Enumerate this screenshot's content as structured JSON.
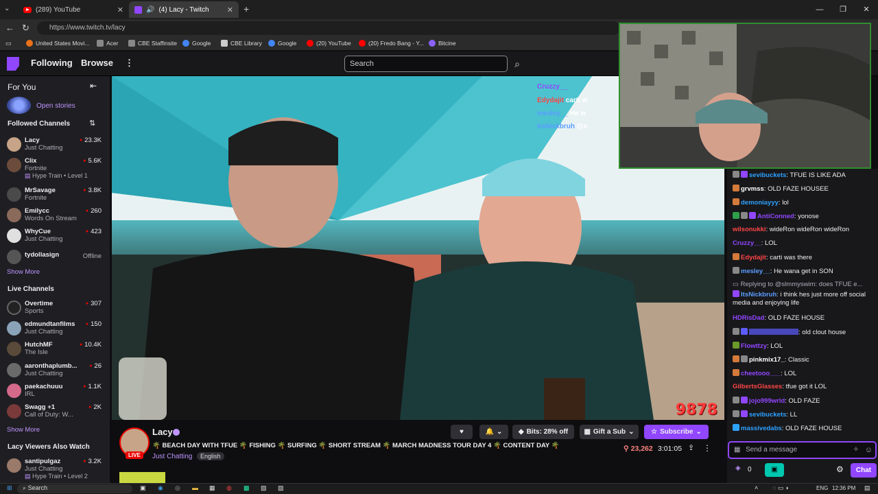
{
  "browser": {
    "tabs": [
      {
        "label": "(289) YouTube",
        "icon": "youtube-icon"
      },
      {
        "label": "(4) Lacy - Twitch",
        "icon": "twitch-icon"
      }
    ],
    "url": "https://www.twitch.tv/lacy",
    "bookmarks": [
      "United States Movi...",
      "Acer",
      "CBE Staffinsite",
      "Google",
      "CBE Library",
      "Google",
      "(20) YouTube",
      "(20) Fredo Bang - Y...",
      "Bitcine"
    ]
  },
  "nav": {
    "following": "Following",
    "browse": "Browse",
    "search_placeholder": "Search"
  },
  "sidebar": {
    "for_you": "For You",
    "open_stories": "Open stories",
    "followed_heading": "Followed Channels",
    "followed": [
      {
        "name": "Lacy",
        "game": "Just Chatting",
        "viewers": "23.3K",
        "color": "#c7a487"
      },
      {
        "name": "Clix",
        "game": "Fortnite",
        "viewers": "5.6K",
        "hype": "Hype Train • Level 1",
        "color": "#6b4c3b"
      },
      {
        "name": "MrSavage",
        "game": "Fortnite",
        "viewers": "3.8K",
        "color": "#4a4a4a"
      },
      {
        "name": "Emilycc",
        "game": "Words On Stream",
        "viewers": "260",
        "color": "#8a6a5a"
      },
      {
        "name": "WhyCue",
        "game": "Just Chatting",
        "viewers": "423",
        "color": "#e0e0e0"
      },
      {
        "name": "tydollasign",
        "offline": "Offline",
        "color": "#555"
      }
    ],
    "show_more_1": "Show More",
    "live_heading": "Live Channels",
    "live": [
      {
        "name": "Overtime",
        "game": "Sports",
        "viewers": "307",
        "color": "#222"
      },
      {
        "name": "edmundtanfilms",
        "game": "Just Chatting",
        "viewers": "150",
        "color": "#8aa3b8"
      },
      {
        "name": "HutchMF",
        "game": "The Isle",
        "viewers": "10.4K",
        "color": "#5a4a3a"
      },
      {
        "name": "aaronthaplumb...",
        "game": "Just Chatting",
        "viewers": "26",
        "color": "#6a6a6a"
      },
      {
        "name": "paekachuuu",
        "game": "IRL",
        "viewers": "1.1K",
        "color": "#d46a8a"
      },
      {
        "name": "Swagg +1",
        "game": "Call of Duty: W...",
        "viewers": "2K",
        "color": "#7a3a3a"
      }
    ],
    "show_more_2": "Show More",
    "also_watch_heading": "Lacy Viewers Also Watch",
    "also_watch": [
      {
        "name": "santipulgaz",
        "game": "Just Chatting",
        "viewers": "3.2K",
        "hype": "Hype Train • Level 2",
        "color": "#9a7a6a"
      }
    ]
  },
  "video": {
    "overlay_chat": [
      {
        "name": "Cruzzy__",
        "text": "",
        "color": "#9146ff"
      },
      {
        "name": "Edydajit",
        "text": "carti w",
        "color": "#ff4545"
      },
      {
        "name": "mesley__",
        "text": "He w",
        "color": "#5c9dff"
      },
      {
        "name": "ItsNickbruh",
        "text": "@s",
        "color": "#5c9dff"
      }
    ],
    "score": "9878"
  },
  "stream": {
    "channel": "Lacy",
    "live": "LIVE",
    "title": "🌴 BEACH DAY WITH TFUE 🌴 FISHING 🌴 SURFING 🌴 SHORT STREAM 🌴 MARCH MADNESS TOUR DAY 4 🌴 CONTENT DAY 🌴",
    "category": "Just Chatting",
    "language": "English",
    "bits": "Bits: 28% off",
    "gift": "Gift a Sub",
    "subscribe": "Subscribe",
    "viewers": "23,262",
    "uptime": "3:01:05"
  },
  "chat": {
    "messages": [
      {
        "user": "sevibuckets",
        "text": ": TFUE IS LIKE ADA",
        "color": "#2ea2ff"
      },
      {
        "user": "grvmss",
        "text": ": OLD FAZE HOUSEE",
        "color": "#ffffff"
      },
      {
        "user": "demoniayyy",
        "text": ": lol",
        "color": "#2ea2ff"
      },
      {
        "user": "AntiConned",
        "text": ": yonose",
        "color": "#9146ff"
      },
      {
        "user": "wilsonukki",
        "text": ": wideRon wideRon wideRon",
        "color": "#ff4545"
      },
      {
        "user": "Cruzzy__",
        "text": ": LOL",
        "color": "#9146ff"
      },
      {
        "user": "Edydajit",
        "text": ": carti was there",
        "color": "#ff4545"
      },
      {
        "user": "mesley__",
        "text": ": He wana get in SON",
        "color": "#5c9dff"
      },
      {
        "user": "",
        "text": "Replying to @slmmyswim: does TFUE e...",
        "color": "#adadb8"
      },
      {
        "user": "ItsNickbruh",
        "text": ": i think hes just more off social media and enjoying life",
        "color": "#5c9dff"
      },
      {
        "user": "HDRisDad",
        "text": ": OLD FAZE HOUSE",
        "color": "#9146ff"
      },
      {
        "user": "",
        "text": ": old clout house",
        "color": "#5c5cff"
      },
      {
        "user": "Flowttzy",
        "text": ": LOL",
        "color": "#9146ff"
      },
      {
        "user": "pinkmix17_",
        "text": ": Classic",
        "color": "#ffffff"
      },
      {
        "user": "cheetooo___",
        "text": ": LOL",
        "color": "#9146ff"
      },
      {
        "user": "GilbertsGlasses",
        "text": ": tfue got it LOL",
        "color": "#ff4545"
      },
      {
        "user": "jojo999wrld",
        "text": ": OLD FAZE",
        "color": "#9146ff"
      },
      {
        "user": "sevibuckets",
        "text": ": LL",
        "color": "#2ea2ff"
      },
      {
        "user": "massivedabs",
        "text": ": OLD FAZE HOUSE",
        "color": "#2ea2ff"
      }
    ],
    "input_placeholder": "Send a message",
    "points": "0",
    "chat_button": "Chat"
  },
  "taskbar": {
    "search": "Search",
    "lang": "ENG",
    "time": "12:36 PM"
  },
  "colors": {
    "accent": "#9146ff",
    "live": "#eb0400"
  }
}
